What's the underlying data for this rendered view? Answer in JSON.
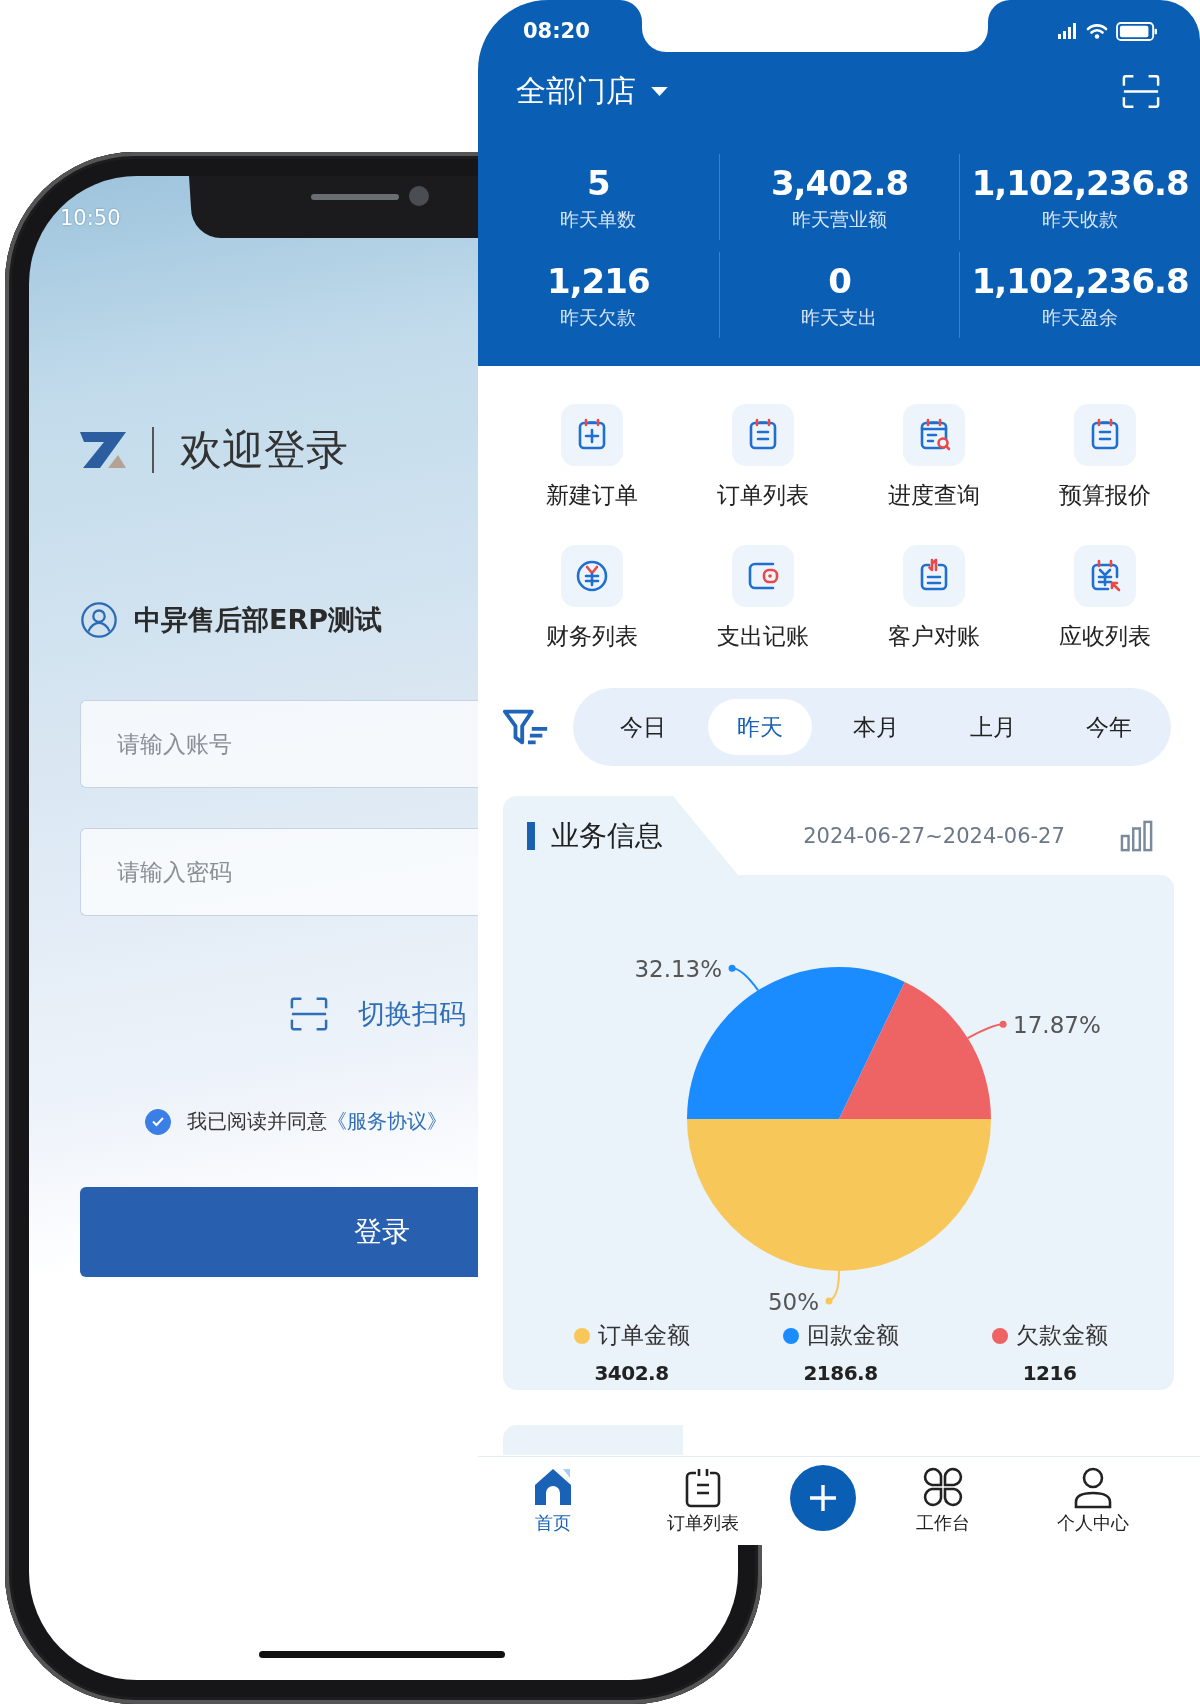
{
  "login_screen": {
    "status_time": "10:50",
    "title": "欢迎登录",
    "company": "中异售后部ERP测试",
    "fields": [
      {
        "placeholder": "请输入账号"
      },
      {
        "placeholder": "请输入密码"
      }
    ],
    "scan_link": "切换扫码",
    "agreement": {
      "checked": true,
      "text": "我已阅读并同意",
      "link": "《服务协议》"
    },
    "login_button": "登录"
  },
  "home_screen": {
    "status_time": "08:20",
    "store_selector": "全部门店",
    "stats": [
      {
        "value": "5",
        "label": "昨天单数"
      },
      {
        "value": "3,402.8",
        "label": "昨天营业额"
      },
      {
        "value": "1,102,236.8",
        "label": "昨天收款"
      },
      {
        "value": "1,216",
        "label": "昨天欠款"
      },
      {
        "value": "0",
        "label": "昨天支出"
      },
      {
        "value": "1,102,236.8",
        "label": "昨天盈余"
      }
    ],
    "shortcuts": [
      {
        "label": "新建订单"
      },
      {
        "label": "订单列表"
      },
      {
        "label": "进度查询"
      },
      {
        "label": "预算报价"
      },
      {
        "label": "财务列表"
      },
      {
        "label": "支出记账"
      },
      {
        "label": "客户对账"
      },
      {
        "label": "应收列表"
      }
    ],
    "period_tabs": [
      {
        "label": "今日",
        "selected": false
      },
      {
        "label": "昨天",
        "selected": true
      },
      {
        "label": "本月",
        "selected": false
      },
      {
        "label": "上月",
        "selected": false
      },
      {
        "label": "今年",
        "selected": false
      }
    ],
    "business_card": {
      "title": "业务信息",
      "date_range": "2024-06-27~2024-06-27",
      "chart_data": {
        "type": "pie",
        "categories": [
          "订单金额",
          "回款金额",
          "欠款金额"
        ],
        "values": [
          50,
          32.13,
          17.87
        ],
        "value_labels": [
          "50%",
          "32.13%",
          "17.87%"
        ],
        "colors": [
          "#f8c75a",
          "#1a8cff",
          "#ee6363"
        ]
      },
      "amounts": [
        "3402.8",
        "2186.8",
        "1216"
      ]
    },
    "bottom_nav": [
      {
        "kind": "tab",
        "label": "首页",
        "selected": true
      },
      {
        "kind": "tab",
        "label": "订单列表",
        "selected": false
      },
      {
        "kind": "add"
      },
      {
        "kind": "tab",
        "label": "工作台",
        "selected": false
      },
      {
        "kind": "tab",
        "label": "个人中心",
        "selected": false
      }
    ]
  }
}
